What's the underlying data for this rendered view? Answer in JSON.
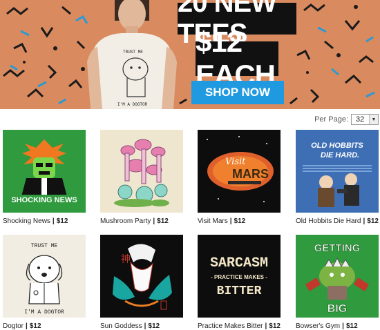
{
  "banner": {
    "headline_line1": "20 NEW TEES",
    "headline_line2": "$12 EACH",
    "cta_label": "SHOP NOW",
    "shirt_text_top": "TRUST ME",
    "shirt_text_bottom": "I'M A DOGTOR"
  },
  "per_page": {
    "label": "Per Page:",
    "value": "32"
  },
  "products": [
    {
      "name": "Shocking News",
      "price": "$12",
      "art_text": "SHOCKING NEWS"
    },
    {
      "name": "Mushroom Party",
      "price": "$12"
    },
    {
      "name": "Visit Mars",
      "price": "$12",
      "art_text": "Visit",
      "art_text2": "MARS"
    },
    {
      "name": "Old Hobbits Die Hard",
      "price": "$12",
      "art_text": "OLD HOBBITS",
      "art_text2": "DIE HARD."
    },
    {
      "name": "Dogtor",
      "price": "$12",
      "art_text": "TRUST ME",
      "art_text2": "I'M A DOGTOR"
    },
    {
      "name": "Sun Goddess",
      "price": "$12"
    },
    {
      "name": "Practice Makes Bitter",
      "price": "$12",
      "art_text": "SARCASM",
      "art_text2": "- PRACTICE MAKES -",
      "art_text3": "BITTER"
    },
    {
      "name": "Bowser's Gym",
      "price": "$12",
      "art_text": "GETTING",
      "art_text2": "BIG"
    }
  ],
  "colors": {
    "banner_bg": "#d98a5e",
    "cta_blue": "#1f9ae0",
    "green_tile": "#2f9a3e",
    "cream_tile": "#efe6cf",
    "black_tile": "#0d0d0d",
    "blue_tile": "#3e6fb5",
    "light_tile": "#f2ede2"
  }
}
